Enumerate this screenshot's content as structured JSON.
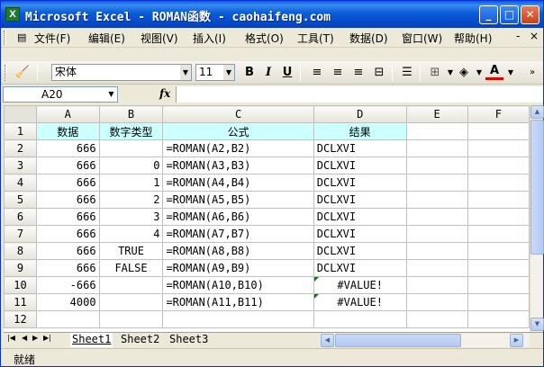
{
  "window": {
    "title": "Microsoft Excel - ROMAN函数 - caohaifeng.com",
    "app_icon_letter": "X",
    "minimize": "_",
    "maximize": "□",
    "close": "✕"
  },
  "menu": {
    "items": [
      "文件(F)",
      "编辑(E)",
      "视图(V)",
      "插入(I)",
      "格式(O)",
      "工具(T)",
      "数据(D)",
      "窗口(W)",
      "帮助(H)"
    ],
    "doc_minimize": "-",
    "doc_close": "×"
  },
  "toolbar": {
    "font_name": "宋体",
    "font_size": "11",
    "bold": "B",
    "italic": "I",
    "underline": "U",
    "font_color": "A"
  },
  "formula_bar": {
    "name_box": "A20",
    "fx": "fx",
    "formula": ""
  },
  "sheet": {
    "columns": [
      "A",
      "B",
      "C",
      "D",
      "E",
      "F"
    ],
    "selected_row": "20",
    "rows": [
      {
        "num": "1",
        "a": "数据",
        "b": "数字类型",
        "c": "公式",
        "d": "结果"
      },
      {
        "num": "2",
        "a": "666",
        "b": "",
        "c": "=ROMAN(A2,B2)",
        "d": "DCLXVI"
      },
      {
        "num": "3",
        "a": "666",
        "b": "0",
        "c": "=ROMAN(A3,B3)",
        "d": "DCLXVI"
      },
      {
        "num": "4",
        "a": "666",
        "b": "1",
        "c": "=ROMAN(A4,B4)",
        "d": "DCLXVI"
      },
      {
        "num": "5",
        "a": "666",
        "b": "2",
        "c": "=ROMAN(A5,B5)",
        "d": "DCLXVI"
      },
      {
        "num": "6",
        "a": "666",
        "b": "3",
        "c": "=ROMAN(A6,B6)",
        "d": "DCLXVI"
      },
      {
        "num": "7",
        "a": "666",
        "b": "4",
        "c": "=ROMAN(A7,B7)",
        "d": "DCLXVI"
      },
      {
        "num": "8",
        "a": "666",
        "b": "TRUE",
        "c": "=ROMAN(A8,B8)",
        "d": "DCLXVI"
      },
      {
        "num": "9",
        "a": "666",
        "b": "FALSE",
        "c": "=ROMAN(A9,B9)",
        "d": "DCLXVI"
      },
      {
        "num": "10",
        "a": "-666",
        "b": "",
        "c": "=ROMAN(A10,B10)",
        "d": "#VALUE!"
      },
      {
        "num": "11",
        "a": "4000",
        "b": "",
        "c": "=ROMAN(A11,B11)",
        "d": "#VALUE!"
      },
      {
        "num": "12",
        "a": "",
        "b": "",
        "c": "",
        "d": ""
      }
    ]
  },
  "tabs": {
    "items": [
      "Sheet1",
      "Sheet2",
      "Sheet3"
    ],
    "active": "Sheet1"
  },
  "status": {
    "text": "就绪"
  },
  "colors": {
    "header_fill": "#ccffff",
    "error_mark": "#008000"
  }
}
